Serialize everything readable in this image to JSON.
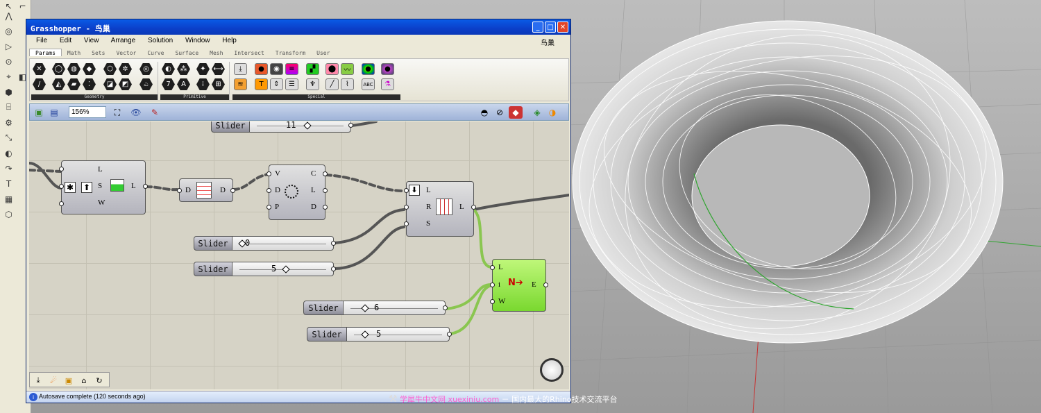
{
  "rhino_toolbar": {
    "icons": [
      "arrow-icon",
      "corner-icon",
      "polyline-icon",
      "circle-icon",
      "arc-icon",
      "curve-icon",
      "point-icon",
      "surface-icon",
      "box-icon",
      "cylinder-icon",
      "gear-icon",
      "transform-icon",
      "boolean-icon",
      "drag-icon",
      "text-icon",
      "grid-icon",
      "mesh-icon"
    ]
  },
  "window": {
    "title": "Grasshopper - 鸟巢",
    "btn_min": "_",
    "btn_max": "□",
    "btn_close": "✕"
  },
  "menu": {
    "items": [
      "File",
      "Edit",
      "View",
      "Arrange",
      "Solution",
      "Window",
      "Help"
    ],
    "right_label": "鸟巢"
  },
  "tabs": [
    "Params",
    "Math",
    "Sets",
    "Vector",
    "Curve",
    "Surface",
    "Mesh",
    "Intersect",
    "Transform",
    "User"
  ],
  "ribbon": {
    "groups": [
      "Geometry",
      "Primitive",
      "Special"
    ]
  },
  "canvas_toolbar": {
    "zoom": "156%",
    "icons": [
      "open-icon",
      "save-icon",
      "zoom-extents-icon",
      "eye-icon",
      "sketch-icon",
      "shaded-icon",
      "wire-icon",
      "preview-icon",
      "bake-icon",
      "color-icon"
    ]
  },
  "canvas": {
    "components": [
      {
        "inputs": [
          "L",
          "S",
          "W"
        ],
        "outputs": [
          "L"
        ]
      },
      {
        "inputs": [
          "D"
        ],
        "outputs": [
          "D"
        ]
      },
      {
        "inputs": [
          "V",
          "D",
          "P"
        ],
        "outputs": [
          "C",
          "L",
          "D"
        ]
      },
      {
        "inputs": [
          "L",
          "R",
          "S"
        ],
        "outputs": [
          "L"
        ]
      },
      {
        "inputs": [
          "L",
          "i",
          "W"
        ],
        "outputs": [
          "E"
        ]
      }
    ],
    "sliders": [
      {
        "label": "Slider",
        "value": "11",
        "knob": 0.6
      },
      {
        "label": "Slider",
        "value": "0",
        "knob": 0.0
      },
      {
        "label": "Slider",
        "value": "5",
        "knob": 0.55
      },
      {
        "label": "Slider",
        "value": "6",
        "knob": 0.15
      },
      {
        "label": "Slider",
        "value": "5",
        "knob": 0.1
      }
    ]
  },
  "status": {
    "text": "Autosave complete (120 seconds ago)"
  },
  "watermark": {
    "link": "学犀牛中文网 xuexiniu.com",
    "text": "－ 国内最大的Rhino技术交流平台"
  }
}
